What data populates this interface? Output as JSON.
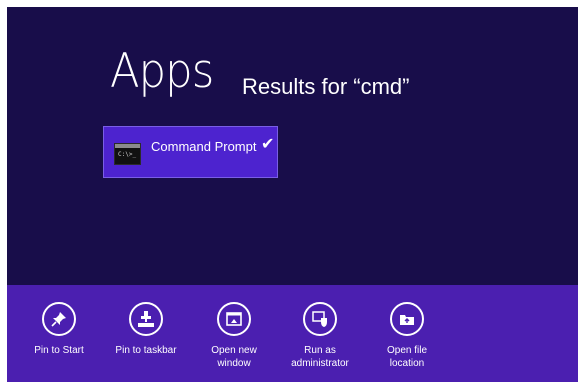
{
  "header": {
    "title": "Apps",
    "subtitle": "Results for “cmd”"
  },
  "results": [
    {
      "label": "Command Prompt",
      "icon_text": "C:\\>_",
      "icon": "command-prompt-icon",
      "selected": true,
      "check": "✔"
    }
  ],
  "app_bar": {
    "commands": [
      {
        "label": "Pin to Start",
        "icon": "pin-icon"
      },
      {
        "label": "Pin to taskbar",
        "icon": "pin-taskbar-icon"
      },
      {
        "label": "Open new\nwindow",
        "icon": "open-window-icon"
      },
      {
        "label": "Run as\nadministrator",
        "icon": "shield-icon"
      },
      {
        "label": "Open file\nlocation",
        "icon": "folder-icon"
      }
    ]
  },
  "colors": {
    "background": "#180d4a",
    "app_bar": "#4b1fb0",
    "selection": "#4d23cf",
    "text": "#ffffff"
  }
}
